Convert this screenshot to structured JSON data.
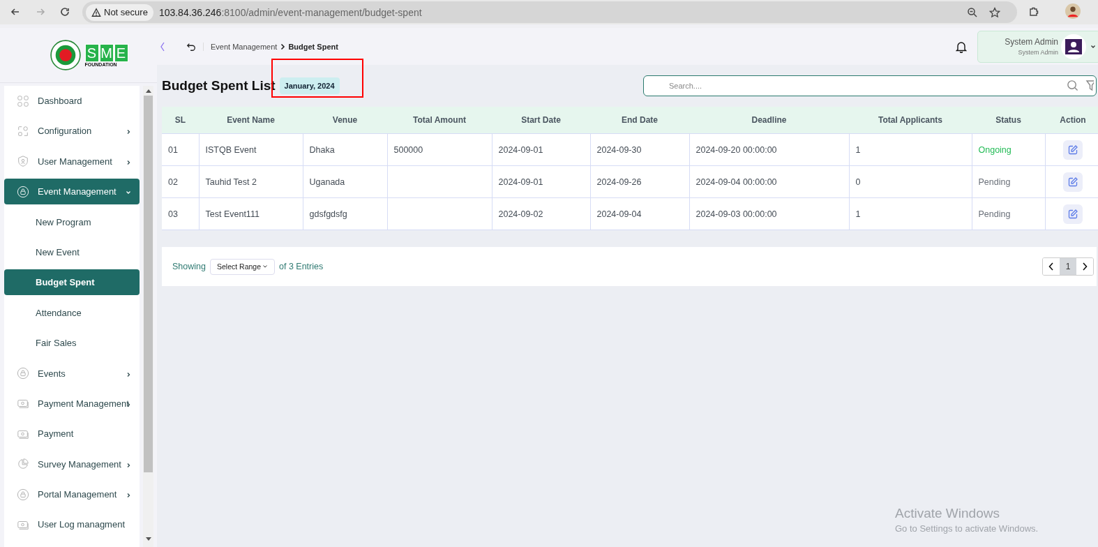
{
  "browser": {
    "security": "Not secure",
    "url_host": "103.84.36.246",
    "url_rest": ":8100/admin/event-management/budget-spent"
  },
  "logo": {
    "letters": [
      "S",
      "M",
      "E"
    ],
    "caption": "FOUNDATION"
  },
  "breadcrumb": [
    {
      "label": "Event Management",
      "current": false
    },
    {
      "label": "Budget Spent",
      "current": true
    }
  ],
  "user": {
    "name": "System Admin",
    "role": "System Admin"
  },
  "sidebar": {
    "items": [
      {
        "label": "Dashboard",
        "expandable": false,
        "selected": false
      },
      {
        "label": "Configuration",
        "expandable": true,
        "selected": false
      },
      {
        "label": "User Management",
        "expandable": true,
        "selected": false
      },
      {
        "label": "Event Management",
        "expandable": true,
        "selected": true,
        "expanded": true,
        "children": [
          {
            "label": "New Program",
            "selected": false
          },
          {
            "label": "New Event",
            "selected": false
          },
          {
            "label": "Budget Spent",
            "selected": true
          },
          {
            "label": "Attendance",
            "selected": false
          },
          {
            "label": "Fair Sales",
            "selected": false
          }
        ]
      },
      {
        "label": "Events",
        "expandable": true,
        "selected": false
      },
      {
        "label": "Payment Management",
        "expandable": true,
        "selected": false
      },
      {
        "label": "Payment",
        "expandable": false,
        "selected": false
      },
      {
        "label": "Survey Management",
        "expandable": true,
        "selected": false
      },
      {
        "label": "Portal Management",
        "expandable": true,
        "selected": false
      },
      {
        "label": "User Log managment",
        "expandable": false,
        "selected": false
      }
    ]
  },
  "page": {
    "title": "Budget Spent List",
    "period": "January, 2024",
    "period_highlighted": true,
    "search": {
      "placeholder": "Search...."
    }
  },
  "table": {
    "columns": [
      "SL",
      "Event Name",
      "Venue",
      "Total Amount",
      "Start Date",
      "End Date",
      "Deadline",
      "Total Applicants",
      "Status",
      "Action"
    ],
    "rows": [
      {
        "cells": [
          "01",
          "ISTQB Event",
          "Dhaka",
          "500000",
          "2024-09-01",
          "2024-09-30",
          "2024-09-20 00:00:00",
          "1"
        ],
        "status": "Ongoing",
        "color": "#22bb55"
      },
      {
        "cells": [
          "02",
          "Tauhid Test 2",
          "Uganada",
          "",
          "2024-09-01",
          "2024-09-26",
          "2024-09-04 00:00:00",
          "0"
        ],
        "status": "Pending",
        "color": "#6a7079"
      },
      {
        "cells": [
          "03",
          "Test Event111",
          "gdsfgdsfg",
          "",
          "2024-09-02",
          "2024-09-04",
          "2024-09-03 00:00:00",
          "1"
        ],
        "status": "Pending",
        "color": "#6a7079"
      }
    ]
  },
  "footer": {
    "showing": "Showing",
    "range": "Select Range",
    "entries": "of 3 Entries",
    "pages": [
      {
        "label": "1",
        "selected": true
      }
    ]
  },
  "os_notice": {
    "title": "Activate Windows",
    "text": "Go to Settings to activate Windows."
  }
}
